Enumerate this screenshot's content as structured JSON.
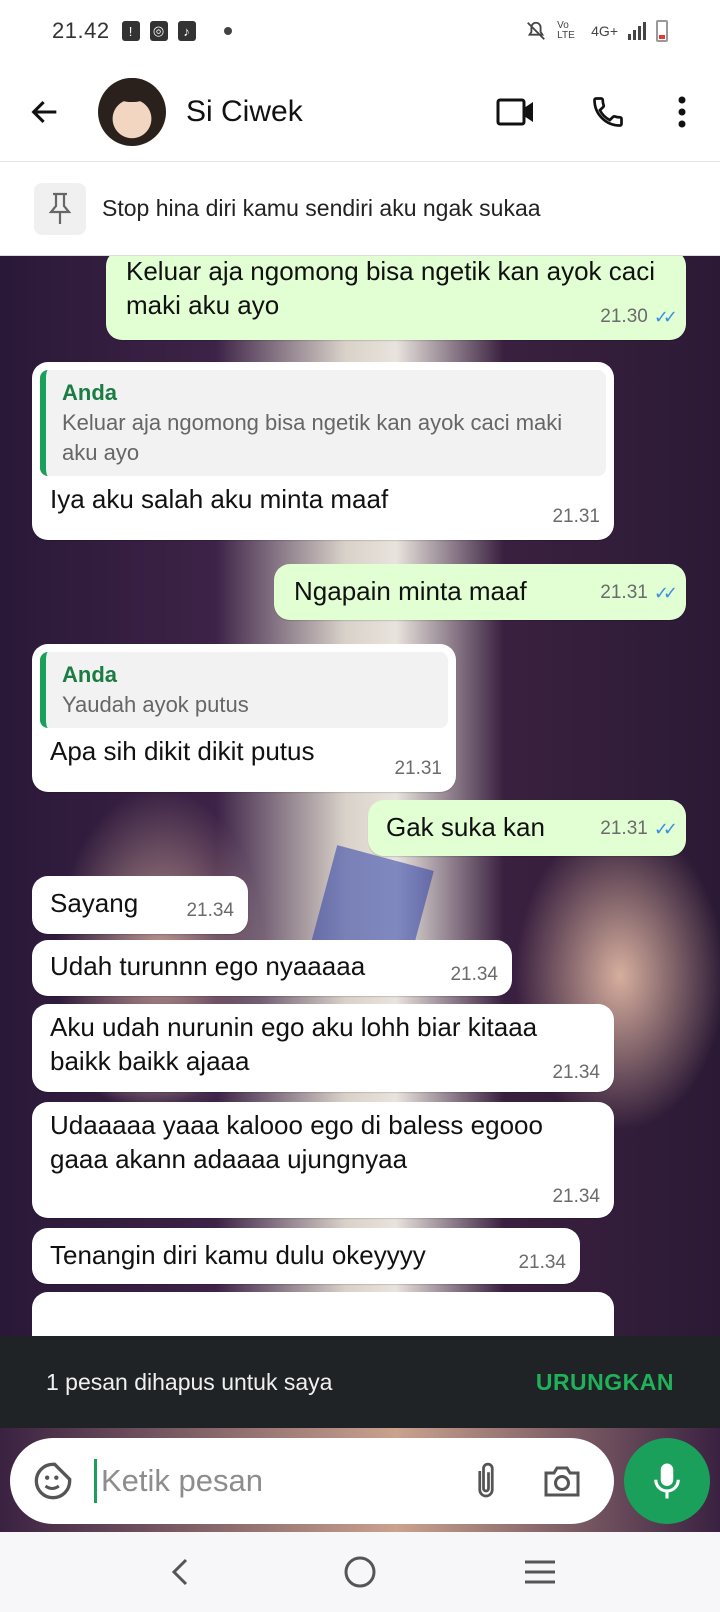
{
  "status_bar": {
    "time": "21.42",
    "network": "4G+",
    "volte": "Vo LTE"
  },
  "header": {
    "contact_name": "Si Ciwek"
  },
  "pinned": {
    "text": "Stop hina diri kamu sendiri aku ngak sukaa"
  },
  "messages": [
    {
      "dir": "out",
      "text": "Keluar aja ngomong bisa ngetik kan ayok caci maki aku ayo",
      "time": "21.30"
    },
    {
      "dir": "in",
      "quote_author": "Anda",
      "quote_text": "Keluar aja ngomong bisa ngetik kan ayok caci maki aku ayo",
      "text": "Iya aku salah aku minta maaf",
      "time": "21.31"
    },
    {
      "dir": "out",
      "text": "Ngapain minta maaf",
      "time": "21.31"
    },
    {
      "dir": "in",
      "quote_author": "Anda",
      "quote_text": "Yaudah ayok putus",
      "text": "Apa sih dikit dikit putus",
      "time": "21.31"
    },
    {
      "dir": "out",
      "text": "Gak suka kan",
      "time": "21.31"
    },
    {
      "dir": "in",
      "text": "Sayang",
      "time": "21.34"
    },
    {
      "dir": "in",
      "text": "Udah turunnn ego  nyaaaaa",
      "time": "21.34"
    },
    {
      "dir": "in",
      "text": "Aku udah nurunin ego aku lohh biar kitaaa baikk baikk ajaaa",
      "time": "21.34"
    },
    {
      "dir": "in",
      "text": "Udaaaaa yaaa kalooo ego di baless egooo gaaa akann adaaaa ujungnyaa",
      "time": "21.34"
    },
    {
      "dir": "in",
      "text": "Tenangin diri kamu dulu okeyyyy",
      "time": "21.34"
    }
  ],
  "snackbar": {
    "text": "1 pesan dihapus untuk saya",
    "action": "URUNGKAN"
  },
  "composer": {
    "placeholder": "Ketik pesan"
  },
  "colors": {
    "accent": "#1aa05a",
    "outgoing_bubble": "#e2ffd4",
    "read_ticks": "#3a8fe0"
  }
}
